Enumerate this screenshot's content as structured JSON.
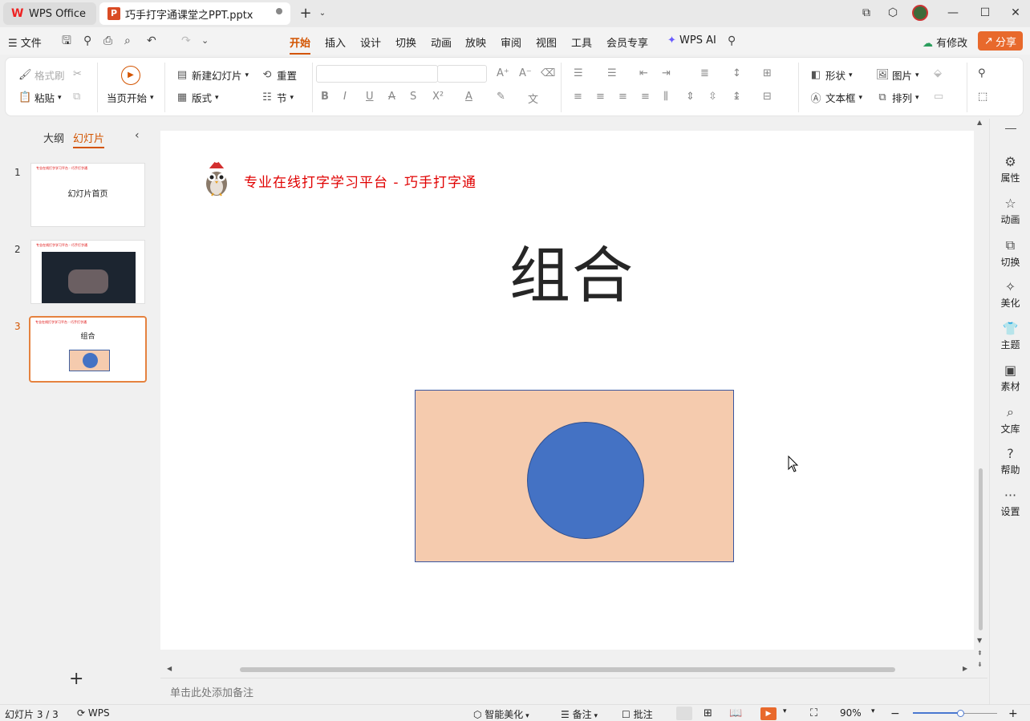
{
  "titlebar": {
    "home_tab": "WPS Office",
    "doc_tab": "巧手打字通课堂之PPT.pptx",
    "new_tab_icon": "plus-icon"
  },
  "menubar": {
    "file": "文件",
    "tabs": [
      "开始",
      "插入",
      "设计",
      "切换",
      "动画",
      "放映",
      "审阅",
      "视图",
      "工具",
      "会员专享"
    ],
    "active_tab": "开始",
    "wps_ai": "WPS AI",
    "has_changes": "有修改",
    "share": "分享"
  },
  "ribbon": {
    "format_painter": "格式刷",
    "paste": "粘贴",
    "play_from_current": "当页开始",
    "new_slide": "新建幻灯片",
    "reset": "重置",
    "layout": "版式",
    "section": "节",
    "shape": "形状",
    "picture": "图片",
    "textbox": "文本框",
    "arrange": "排列"
  },
  "leftpanel": {
    "tab_outline": "大纲",
    "tab_slides": "幻灯片",
    "slides": [
      {
        "num": "1",
        "title": "幻灯片首页"
      },
      {
        "num": "2",
        "title": ""
      },
      {
        "num": "3",
        "title": "组合"
      }
    ],
    "header_mini": "专业在线打字学习平台 - 巧手打字通"
  },
  "slide": {
    "header_text": "专业在线打字学习平台 - 巧手打字通",
    "title": "组合",
    "rect_color": "#f5cbae",
    "circle_color": "#4472c4",
    "header_color": "#e00000"
  },
  "notes": {
    "placeholder": "单击此处添加备注"
  },
  "rightpanel": {
    "items": [
      "属性",
      "动画",
      "切换",
      "美化",
      "主题",
      "素材",
      "文库",
      "帮助",
      "设置"
    ]
  },
  "statusbar": {
    "slide_count": "幻灯片 3 / 3",
    "wps": "WPS",
    "smart_beautify": "智能美化",
    "notes": "备注",
    "comments": "批注",
    "zoom": "90%",
    "zoom_level": 0.57
  }
}
